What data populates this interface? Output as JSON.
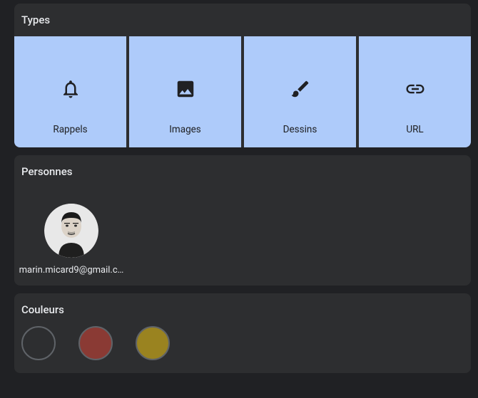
{
  "sections": {
    "types": {
      "title": "Types",
      "items": [
        {
          "name": "rappels",
          "label": "Rappels",
          "icon": "bell"
        },
        {
          "name": "images",
          "label": "Images",
          "icon": "image"
        },
        {
          "name": "dessins",
          "label": "Dessins",
          "icon": "brush"
        },
        {
          "name": "url",
          "label": "URL",
          "icon": "link"
        }
      ]
    },
    "people": {
      "title": "Personnes",
      "items": [
        {
          "label": "marin.micard9@gmail.c…"
        }
      ]
    },
    "colors": {
      "title": "Couleurs",
      "items": [
        {
          "name": "dark",
          "hex": "#2d2e30"
        },
        {
          "name": "red",
          "hex": "#8a3a34"
        },
        {
          "name": "olive",
          "hex": "#9a8320"
        }
      ]
    }
  }
}
